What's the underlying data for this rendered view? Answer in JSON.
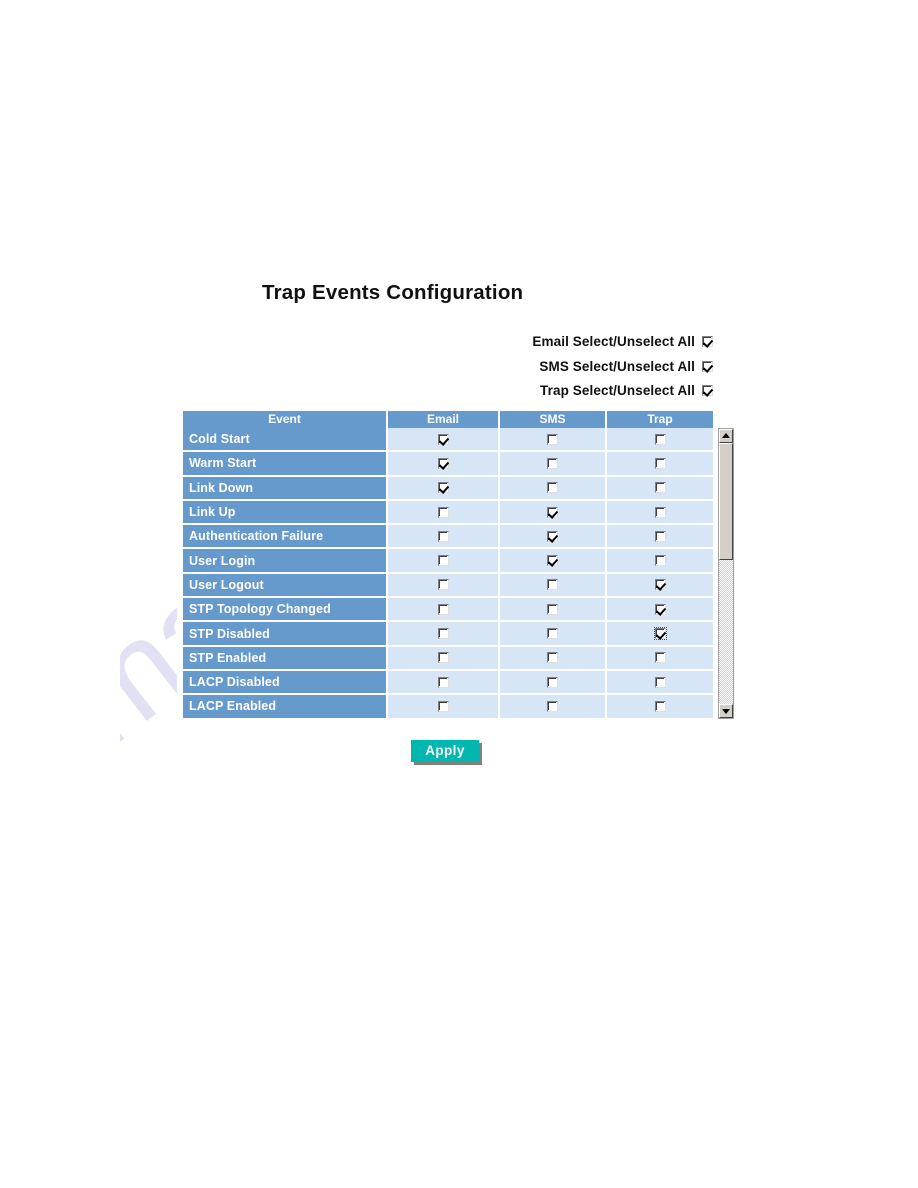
{
  "page": {
    "title": "Trap Events Configuration",
    "watermark": "manualshive.com"
  },
  "colors": {
    "header_blue": "#6699cc",
    "row_label_blue": "#6699cc",
    "checkbox_cell_blue": "#d6e6f7",
    "apply_teal": "#00b8b0",
    "apply_shadow": "#808080",
    "page_background": "#ffffff",
    "watermark": "#c9c9ea"
  },
  "select_all": [
    {
      "label": "Email Select/Unselect All",
      "checked": true,
      "name": "email-select-all"
    },
    {
      "label": "SMS Select/Unselect All",
      "checked": true,
      "name": "sms-select-all"
    },
    {
      "label": "Trap Select/Unselect All",
      "checked": true,
      "name": "trap-select-all"
    }
  ],
  "table": {
    "columns": [
      "Event",
      "Email",
      "SMS",
      "Trap"
    ],
    "rows": [
      {
        "event": "Cold Start",
        "email": true,
        "sms": false,
        "trap": false
      },
      {
        "event": "Warm Start",
        "email": true,
        "sms": false,
        "trap": false
      },
      {
        "event": "Link Down",
        "email": true,
        "sms": false,
        "trap": false
      },
      {
        "event": "Link Up",
        "email": false,
        "sms": true,
        "trap": false
      },
      {
        "event": "Authentication Failure",
        "email": false,
        "sms": true,
        "trap": false
      },
      {
        "event": "User Login",
        "email": false,
        "sms": true,
        "trap": false
      },
      {
        "event": "User Logout",
        "email": false,
        "sms": false,
        "trap": true
      },
      {
        "event": "STP Topology Changed",
        "email": false,
        "sms": false,
        "trap": true
      },
      {
        "event": "STP Disabled",
        "email": false,
        "sms": false,
        "trap": true,
        "focused": true
      },
      {
        "event": "STP Enabled",
        "email": false,
        "sms": false,
        "trap": false
      },
      {
        "event": "LACP Disabled",
        "email": false,
        "sms": false,
        "trap": false
      },
      {
        "event": "LACP Enabled",
        "email": false,
        "sms": false,
        "trap": false
      }
    ]
  },
  "scrollbar": {
    "up_arrow_icon": "triangle-up-icon",
    "down_arrow_icon": "triangle-down-icon",
    "thumb_position_percent": 0,
    "thumb_size_percent": 45
  },
  "apply": {
    "label": "Apply"
  }
}
